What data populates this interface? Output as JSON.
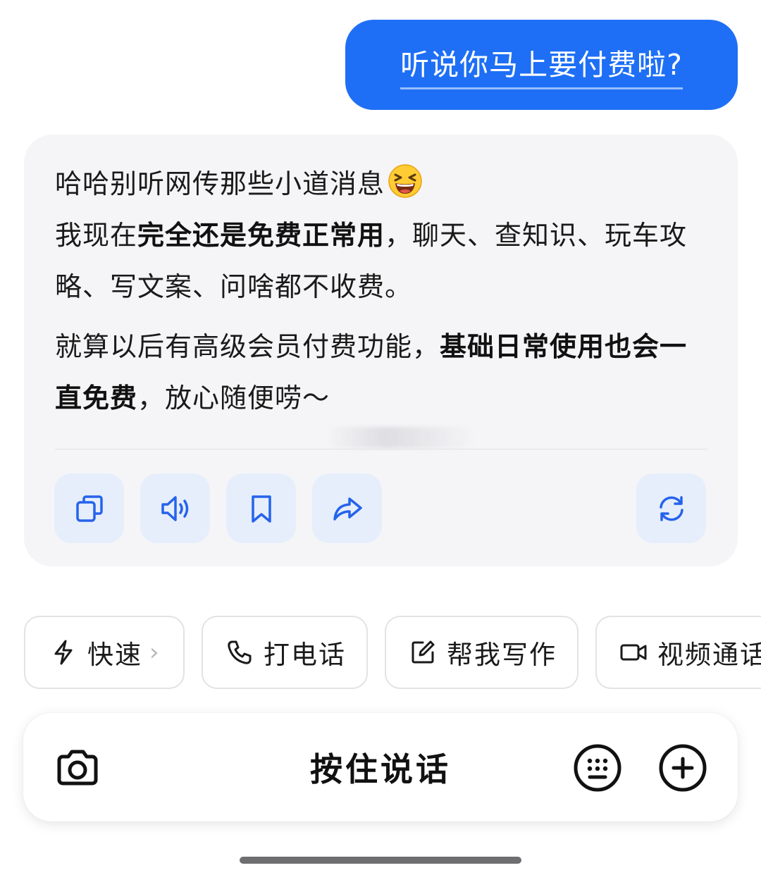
{
  "user_message": "听说你马上要付费啦?",
  "reply": {
    "p1_line1": "哈哈别听网传那些小道消息",
    "p1_line2_pre": "我现在",
    "p1_line2_bold": "完全还是免费正常用",
    "p1_line2_post": "，聊天、查知识、玩车攻略、写文案、问啥都不收费。",
    "p2_pre": "就算以后有高级会员付费功能，",
    "p2_bold": "基础日常使用也会一直免费",
    "p2_post": "，放心随便唠～"
  },
  "actions": [
    {
      "icon": "copy-icon"
    },
    {
      "icon": "speaker-icon"
    },
    {
      "icon": "bookmark-icon"
    },
    {
      "icon": "share-icon"
    },
    {
      "icon": "regenerate-icon"
    }
  ],
  "chips": [
    {
      "label": "快速",
      "icon": "lightning-icon"
    },
    {
      "label": "打电话",
      "icon": "phone-icon"
    },
    {
      "label": "帮我写作",
      "icon": "edit-icon"
    },
    {
      "label": "视频通话",
      "icon": "video-icon"
    }
  ],
  "input_bar": {
    "hold_to_talk": "按住说话"
  },
  "colors": {
    "accent": "#1e6ff5",
    "icon_blue": "#2563eb",
    "action_bg": "#e6eefc"
  }
}
